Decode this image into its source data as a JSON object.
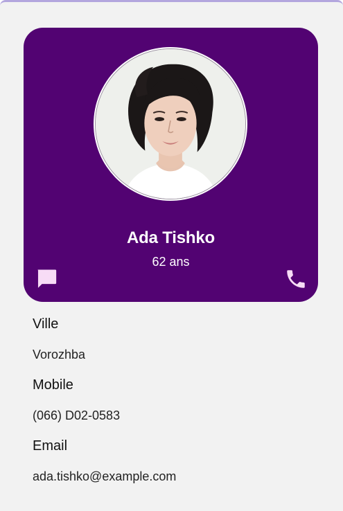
{
  "profile": {
    "name": "Ada Tishko",
    "age": "62 ans",
    "avatar_alt": "portrait photo",
    "card_color": "#520372",
    "icon_color": "#f7dcf6",
    "message_icon": "chat-bubble-icon",
    "phone_icon": "phone-icon"
  },
  "details": [
    {
      "label": "Ville",
      "value": "Vorozhba"
    },
    {
      "label": "Mobile",
      "value": "(066) D02-0583"
    },
    {
      "label": "Email",
      "value": "ada.tishko@example.com"
    }
  ]
}
